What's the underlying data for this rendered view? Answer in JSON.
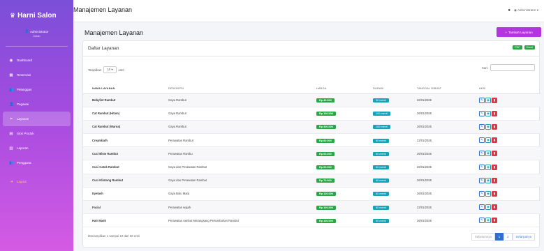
{
  "app": {
    "brand": "Harni Salon",
    "user_name": "Administrator",
    "user_role": "Admin"
  },
  "nav": [
    {
      "label": "Dashboard",
      "icon": "gauge-icon"
    },
    {
      "label": "Reservasi",
      "icon": "calendar-icon"
    },
    {
      "label": "Pelanggan",
      "icon": "users-icon"
    },
    {
      "label": "Pegawai",
      "icon": "person-icon"
    },
    {
      "label": "Layanan",
      "icon": "scissors-icon",
      "active": true
    },
    {
      "label": "Stok Produk",
      "icon": "boxes-icon"
    },
    {
      "label": "Laporan",
      "icon": "chart-icon"
    },
    {
      "label": "Pengguna",
      "icon": "user-gear-icon"
    },
    {
      "label": "Logout",
      "icon": "logout-icon"
    }
  ],
  "topbar": {
    "title": "Manajemen Layanan",
    "account": "Administrator"
  },
  "page": {
    "title": "Manajemen Layanan",
    "add_button": "Tambah Layanan"
  },
  "card": {
    "title": "Daftar Layanan",
    "export_pdf": "PDF",
    "export_excel": "Excel",
    "show_label": "Tampilkan",
    "show_value": "10",
    "entries_label": "entri",
    "search_label": "Cari:"
  },
  "table": {
    "headers": [
      "NAMA LAYANAN",
      "DESKRIPSI",
      "HARGA",
      "DURASI",
      "TANGGAL DIBUAT",
      "AKSI"
    ],
    "rows": [
      {
        "name": "Bobylist Rambut",
        "desc": "Gaya Rambut",
        "price": "Rp 40.000",
        "duration": "30 menit",
        "date": "26/01/2026"
      },
      {
        "name": "Cat Rambut (Hitam)",
        "desc": "Gaya Rambut",
        "price": "Rp 100.000",
        "duration": "120 menit",
        "date": "26/01/2026"
      },
      {
        "name": "Cat Rambut (Warna)",
        "desc": "Gaya Rambut",
        "price": "Rp 300.000",
        "duration": "150 menit",
        "date": "26/01/2026"
      },
      {
        "name": "Creambath",
        "desc": "Perawatan Rambut",
        "price": "Rp 80.000",
        "duration": "60 menit",
        "date": "22/01/2026"
      },
      {
        "name": "Cuci Blow Rambut",
        "desc": "Perawatan Rambu",
        "price": "Rp 60.000",
        "duration": "60 menit",
        "date": "26/01/2026"
      },
      {
        "name": "Cuci Catok Rambut",
        "desc": "Gaya dan Perawatan Rambut",
        "price": "Rp 60.000",
        "duration": "60 menit",
        "date": "26/01/2026"
      },
      {
        "name": "Cuci Klintong Rambut",
        "desc": "Gaya dan Perawatan Rambut",
        "price": "Rp 70.000",
        "duration": "60 menit",
        "date": "26/01/2026"
      },
      {
        "name": "Eyelash",
        "desc": "Gaya Bulu Mata",
        "price": "Rp 120.000",
        "duration": "60 menit",
        "date": "26/01/2026"
      },
      {
        "name": "Facial",
        "desc": "Perawatan wajah",
        "price": "Rp 100.000",
        "duration": "60 menit",
        "date": "22/01/2026"
      },
      {
        "name": "Hair Mask",
        "desc": "Perawatan rambut Merangsang Pertumbuhan Rambut",
        "price": "Rp 100.000",
        "duration": "60 menit",
        "date": "26/01/2026"
      }
    ]
  },
  "footer": {
    "info": "Menampilkan 1 sampai 10 dari 20 entri",
    "prev": "Sebelumnya",
    "pages": [
      "1",
      "2"
    ],
    "current_page": "1",
    "next": "Selanjutnya"
  },
  "colors": {
    "sidebar_start": "#7b4fd8",
    "sidebar_end": "#d45be3",
    "accent": "#b335e0",
    "price_badge": "#28a745",
    "duration_badge": "#17a2b8"
  }
}
